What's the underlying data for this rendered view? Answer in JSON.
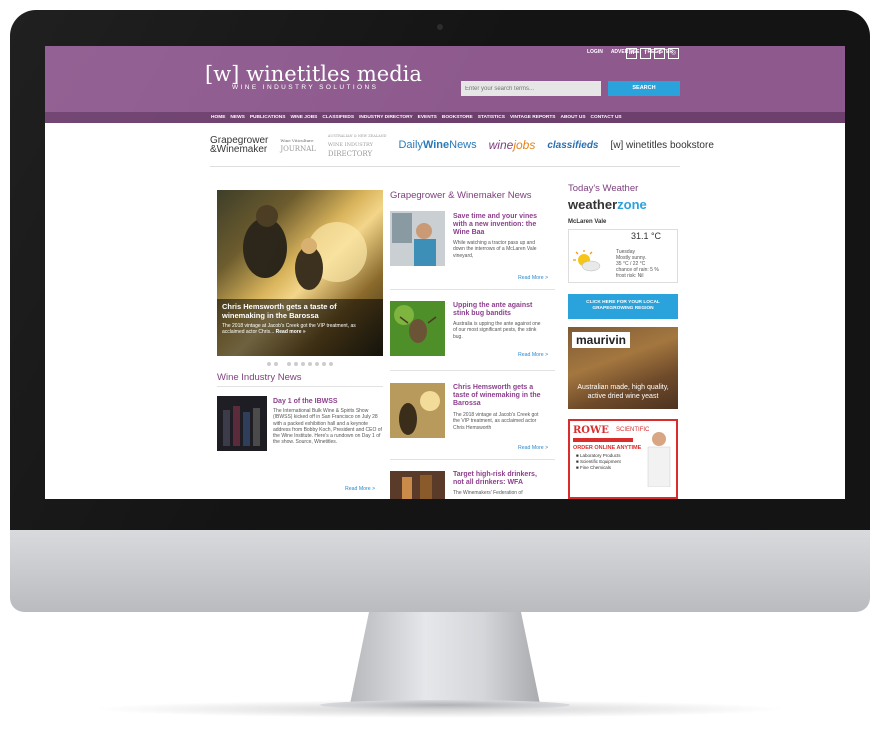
{
  "header": {
    "top_links": [
      "LOGIN",
      "ADVERTISE",
      "REGISTER"
    ],
    "social": [
      {
        "icon": "linkedin-icon",
        "glyph": "in"
      },
      {
        "icon": "facebook-icon",
        "glyph": "f"
      },
      {
        "icon": "twitter-icon",
        "glyph": "t"
      },
      {
        "icon": "instagram-icon",
        "glyph": "◎"
      }
    ],
    "logo_bracket": "[w]",
    "logo_name": "winetitles media",
    "logo_sub": "WINE INDUSTRY SOLUTIONS",
    "search_placeholder": "Enter your search terms...",
    "search_button": "SEARCH"
  },
  "nav": {
    "items": [
      "HOME",
      "NEWS",
      "PUBLICATIONS",
      "WINE JOBS",
      "CLASSIFIEDS",
      "INDUSTRY DIRECTORY",
      "EVENTS",
      "BOOKSTORE",
      "STATISTICS",
      "VINTAGE REPORTS",
      "ABOUT US",
      "CONTACT US"
    ]
  },
  "partners": {
    "grapegrower_1": "Grapegrower",
    "grapegrower_2": "&Winemaker",
    "journal_1": "Wine Viticulture",
    "journal_2": "JOURNAL",
    "directory_1": "AUSTRALIAN & NEW ZEALAND",
    "directory_2": "WINE INDUSTRY",
    "directory_3": "DIRECTORY",
    "dailywinenews_1": "Daily",
    "dailywinenews_2": "Wine",
    "dailywinenews_3": "News",
    "winejobs_1": "wine",
    "winejobs_2": "jobs",
    "classifieds": "classifieds",
    "bookstore": "[w] winetitles bookstore"
  },
  "hero": {
    "title": "Chris Hemsworth gets a taste of winemaking in the Barossa",
    "text": "The 2018 vintage at Jacob's Creek got the VIP treatment, as acclaimed actor Chris...",
    "read_more": "Read more »"
  },
  "wine_industry": {
    "heading": "Wine Industry News",
    "title": "Day 1 of the IBWSS",
    "text": "The International Bulk Wine & Spirits Show (IBWSS) kicked off in San Francisco on July 28 with a packed exhibition hall and a keynote address from Bobby Koch, President and CEO of the Wine Institute. Here's a rundown on Day 1 of the show. Source, Winetitles.",
    "read_more": "Read More >"
  },
  "gw_news": {
    "heading": "Grapegrower & Winemaker News",
    "items": [
      {
        "title": "Save time and your vines with a new invention: the Wine Baa",
        "text": "While watching a tractor pass up and down the interrows of a McLaren Vale vineyard,",
        "read_more": "Read More >"
      },
      {
        "title": "Upping the ante against stink bug bandits",
        "text": "Australia is upping the ante against one of our most significant pests, the stink bug.",
        "read_more": "Read More >"
      },
      {
        "title": "Chris Hemsworth gets a taste of winemaking in the Barossa",
        "text": "The 2018 vintage at Jacob's Creek got the VIP treatment, as acclaimed actor Chris Hemsworth",
        "read_more": "Read More >"
      },
      {
        "title": "Target high-risk drinkers, not all drinkers: WFA",
        "text": "The Winemakers' Federation of"
      }
    ]
  },
  "weather": {
    "heading": "Today's Weather",
    "brand_a": "weather",
    "brand_b": "zone",
    "location": "McLaren Vale",
    "temp": "31.1 °C",
    "day": "Tuesday",
    "desc": "Mostly sunny.",
    "range": "35 °C / 22 °C",
    "rain": "chance of rain: 5 %",
    "frost": "frost risk: Nil",
    "button": "CLICK HERE FOR YOUR LOCAL GRAPEGROWING REGION"
  },
  "ads": {
    "maurivin_logo": "maurivin",
    "maurivin_tag": "Australian made, high quality, active dried wine yeast",
    "rowe_name": "ROWE",
    "rowe_sci": "SCIENTIFIC",
    "rowe_order": "ORDER ONLINE ANYTIME",
    "rowe_items": [
      "Laboratory Products",
      "Scientific Equipment",
      "Fine Chemicals"
    ]
  },
  "colors": {
    "brand_purple": "#8e5a8e",
    "nav_purple": "#6d3f6d",
    "title_purple": "#8e3f8e",
    "accent_blue": "#2aa3dd"
  }
}
